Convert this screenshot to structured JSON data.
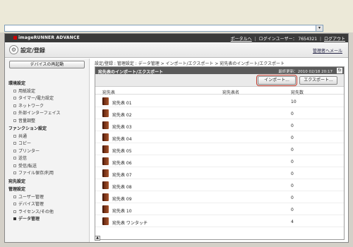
{
  "app": {
    "brand": "imageRUNNER ADVANCE",
    "portal_label": "ポータルへ",
    "login_user_label": "ログインユーザー：",
    "login_user_id": "7654321",
    "logout_label": "ログアウト",
    "page_title": "設定/登録",
    "admin_mail_label": "管理者へメール"
  },
  "sidebar": {
    "restart_label": "デバイスの再起動",
    "entries": [
      {
        "label": "環境設定",
        "type": "cat"
      },
      {
        "label": "用紙設定",
        "type": "item"
      },
      {
        "label": "タイマー/電力設定",
        "type": "item"
      },
      {
        "label": "ネットワーク",
        "type": "item"
      },
      {
        "label": "外部インターフェイス",
        "type": "item"
      },
      {
        "label": "音量調整",
        "type": "item"
      },
      {
        "label": "ファンクション設定",
        "type": "cat"
      },
      {
        "label": "共通",
        "type": "item"
      },
      {
        "label": "コピー",
        "type": "item"
      },
      {
        "label": "プリンター",
        "type": "item"
      },
      {
        "label": "送信",
        "type": "item"
      },
      {
        "label": "受信/転送",
        "type": "item"
      },
      {
        "label": "ファイル保存/利用",
        "type": "item"
      },
      {
        "label": "宛先設定",
        "type": "cat"
      },
      {
        "label": "管理設定",
        "type": "cat"
      },
      {
        "label": "ユーザー管理",
        "type": "item"
      },
      {
        "label": "デバイス管理",
        "type": "item"
      },
      {
        "label": "ライセンス/その他",
        "type": "item"
      },
      {
        "label": "データ管理",
        "type": "item",
        "active": true
      }
    ]
  },
  "breadcrumb": "設定/登録 : 管理設定 : データ管理 > インポート/エクスポート > 宛先表のインポート/エクスポート",
  "panel": {
    "title": "宛先表のインポート/エクスポート",
    "last_updated_label": "最終更新：",
    "last_updated_value": "2010 02/18 20:17",
    "import_label": "インポート...",
    "export_label": "エクスポート...",
    "columns": {
      "book": "宛先表",
      "name": "宛先表名",
      "count": "宛先数"
    },
    "rows": [
      {
        "book": "宛先表 01",
        "name": "",
        "count": "10"
      },
      {
        "book": "宛先表 02",
        "name": "",
        "count": "0"
      },
      {
        "book": "宛先表 03",
        "name": "",
        "count": "0"
      },
      {
        "book": "宛先表 04",
        "name": "",
        "count": "0"
      },
      {
        "book": "宛先表 05",
        "name": "",
        "count": "0"
      },
      {
        "book": "宛先表 06",
        "name": "",
        "count": "0"
      },
      {
        "book": "宛先表 07",
        "name": "",
        "count": "0"
      },
      {
        "book": "宛先表 08",
        "name": "",
        "count": "0"
      },
      {
        "book": "宛先表 09",
        "name": "",
        "count": "0"
      },
      {
        "book": "宛先表 10",
        "name": "",
        "count": "0"
      },
      {
        "book": "宛先表 ワンタッチ",
        "name": "",
        "count": "4"
      }
    ]
  },
  "icons": {
    "title_icon": "settings-wrench-icon",
    "book_icon": "address-book-icon",
    "refresh_icon": "refresh-icon",
    "top_icon": "back-to-top-icon"
  },
  "colors": {
    "topbar": "#3a3a3a",
    "panel_header": "#5a5a5a",
    "highlight": "#c0392b",
    "book": "#8b3a1a"
  }
}
